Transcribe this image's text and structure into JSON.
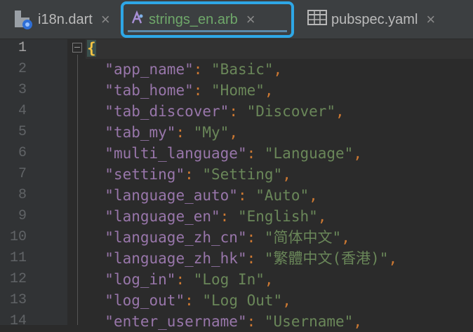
{
  "tabs": [
    {
      "label": "i18n.dart",
      "icon": "dart-file-icon",
      "close": "×"
    },
    {
      "label": "strings_en.arb",
      "icon": "arb-file-icon",
      "close": "×",
      "active": true
    },
    {
      "label": "pubspec.yaml",
      "icon": "yaml-file-icon",
      "close": "×"
    }
  ],
  "editor": {
    "open_brace": "{",
    "lines": [
      {
        "num": "1"
      },
      {
        "num": "2",
        "key": "\"app_name\"",
        "value": "\"Basic\""
      },
      {
        "num": "3",
        "key": "\"tab_home\"",
        "value": "\"Home\""
      },
      {
        "num": "4",
        "key": "\"tab_discover\"",
        "value": "\"Discover\""
      },
      {
        "num": "5",
        "key": "\"tab_my\"",
        "value": "\"My\""
      },
      {
        "num": "6",
        "key": "\"multi_language\"",
        "value": "\"Language\""
      },
      {
        "num": "7",
        "key": "\"setting\"",
        "value": "\"Setting\""
      },
      {
        "num": "8",
        "key": "\"language_auto\"",
        "value": "\"Auto\""
      },
      {
        "num": "9",
        "key": "\"language_en\"",
        "value": "\"English\""
      },
      {
        "num": "10",
        "key": "\"language_zh_cn\"",
        "value": "\"简体中文\""
      },
      {
        "num": "11",
        "key": "\"language_zh_hk\"",
        "value": "\"繁體中文(香港)\""
      },
      {
        "num": "12",
        "key": "\"log_in\"",
        "value": "\"Log In\""
      },
      {
        "num": "13",
        "key": "\"log_out\"",
        "value": "\"Log Out\""
      },
      {
        "num": "14",
        "key": "\"enter_username\"",
        "value": "\"Username\""
      }
    ]
  },
  "colors": {
    "accent": "#2ea7e6",
    "key": "#9876aa",
    "string": "#6a8759",
    "punctuation": "#cc7832",
    "background": "#2b2b2b"
  }
}
